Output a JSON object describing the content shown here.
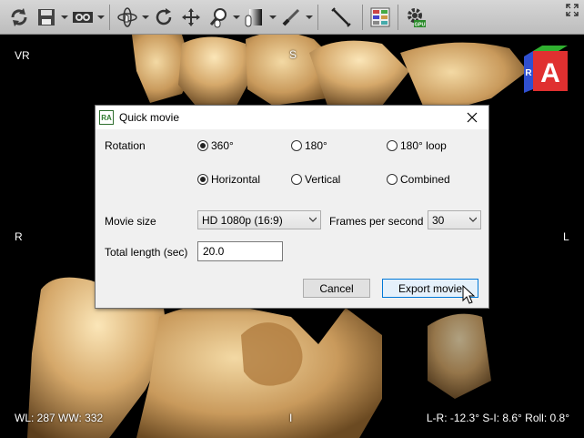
{
  "toolbar": {
    "icons": [
      "reset-icon",
      "save-icon",
      "stereo-view-icon",
      "rotate-3d-icon",
      "rotate-icon",
      "pan-icon",
      "zoom-icon",
      "window-level-icon",
      "scalpel-icon",
      "measure-icon",
      "layout-icon",
      "gpu-settings-icon",
      "maximize-icon"
    ],
    "gpu_label": "GPU"
  },
  "viewport": {
    "labels": {
      "top_left": "VR",
      "top": "S",
      "left": "R",
      "right": "L",
      "bottom": "I",
      "window_level": "WL: 287 WW: 332",
      "orientation": "L-R: -12.3° S-I: 8.6° Roll: 0.8°"
    },
    "cube": {
      "front": "A",
      "side": "R",
      "colors": {
        "front": "#e03030",
        "side": "#3050d0",
        "top": "#30b030"
      }
    }
  },
  "dialog": {
    "title": "Quick movie",
    "icon_text": "RA",
    "rotation_label": "Rotation",
    "rotation_options": [
      {
        "label": "360°",
        "selected": true
      },
      {
        "label": "180°",
        "selected": false
      },
      {
        "label": "180° loop",
        "selected": false
      }
    ],
    "axis_options": [
      {
        "label": "Horizontal",
        "selected": true
      },
      {
        "label": "Vertical",
        "selected": false
      },
      {
        "label": "Combined",
        "selected": false
      }
    ],
    "movie_size_label": "Movie size",
    "movie_size_value": "HD 1080p (16:9)",
    "fps_label": "Frames per second",
    "fps_value": "30",
    "total_length_label": "Total length (sec)",
    "total_length_value": "20.0",
    "cancel_label": "Cancel",
    "export_label": "Export movie"
  }
}
